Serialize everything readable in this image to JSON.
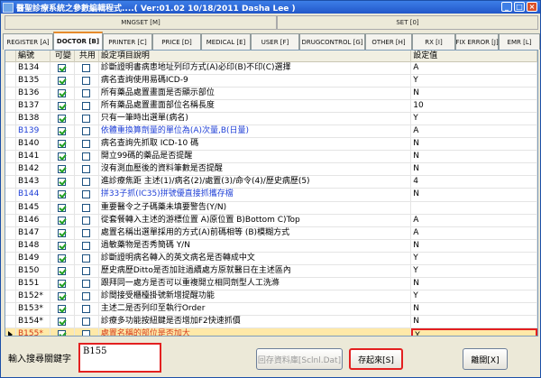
{
  "window": {
    "title": "醫聖診療系統之參數編輯程式....( Ver:01.02 10/18/2011 Dasha Lee )",
    "buttons": {
      "minimize": "_",
      "maximize": "□",
      "close": "×"
    }
  },
  "groups": [
    "MNGSET [M]",
    "SET [0]"
  ],
  "tabs": [
    {
      "label": "REGISTER [A]",
      "active": false
    },
    {
      "label": "DOCTOR [B]",
      "active": true
    },
    {
      "label": "PRINTER [C]",
      "active": false
    },
    {
      "label": "PRICE [D]",
      "active": false
    },
    {
      "label": "MEDICAL [E]",
      "active": false
    },
    {
      "label": "USER [F]",
      "active": false
    },
    {
      "label": "DRUGCONTROL [G]",
      "active": false
    },
    {
      "label": "OTHER [H]",
      "active": false
    },
    {
      "label": "RX [I]",
      "active": false
    },
    {
      "label": "FIX ERROR [J]",
      "active": false
    },
    {
      "label": "EMR [L]",
      "active": false
    }
  ],
  "grid": {
    "headers": {
      "code": "編號",
      "changeable": "可變",
      "common": "共用",
      "description": "設定項目說明",
      "value": "設定值"
    },
    "rows": [
      {
        "code": "B134",
        "chg": true,
        "com": false,
        "desc": "診斷證明書病患地址列印方式(A)必印(B)不印(C)選擇",
        "val": "A",
        "style": ""
      },
      {
        "code": "B135",
        "chg": true,
        "com": false,
        "desc": "病名查詢使用易碼ICD-9",
        "val": "Y",
        "style": ""
      },
      {
        "code": "B136",
        "chg": true,
        "com": false,
        "desc": "所有藥品處置畫面是否顯示部位",
        "val": "N",
        "style": ""
      },
      {
        "code": "B137",
        "chg": true,
        "com": false,
        "desc": "所有藥品處置畫面部位名稱長度",
        "val": "10",
        "style": ""
      },
      {
        "code": "B138",
        "chg": true,
        "com": false,
        "desc": "只有一筆時出選單(病名)",
        "val": "Y",
        "style": ""
      },
      {
        "code": "B139",
        "chg": true,
        "com": false,
        "desc": "依體重換算劑量的單位為(A)次量,B(日量)",
        "val": "A",
        "style": "blue"
      },
      {
        "code": "B140",
        "chg": true,
        "com": false,
        "desc": "病名查詢先抓取 ICD-10 碼",
        "val": "N",
        "style": ""
      },
      {
        "code": "B141",
        "chg": true,
        "com": false,
        "desc": "開立99碼的藥品是否提醒",
        "val": "N",
        "style": ""
      },
      {
        "code": "B142",
        "chg": true,
        "com": false,
        "desc": "沒有測血壓後的資料筆數是否提醒",
        "val": "N",
        "style": ""
      },
      {
        "code": "B143",
        "chg": true,
        "com": false,
        "desc": "進診療焦距 主述(1)/病名(2)/處置(3)/命令(4)/歷史病歷(5)",
        "val": "4",
        "style": ""
      },
      {
        "code": "B144",
        "chg": true,
        "com": false,
        "desc": "拼33子抓(IC35)拼號優直接抓攜存檔",
        "val": "N",
        "style": "blue"
      },
      {
        "code": "B145",
        "chg": true,
        "com": false,
        "desc": "重要醫令之子碼藥未填要警告(Y/N)",
        "val": "",
        "style": ""
      },
      {
        "code": "B146",
        "chg": true,
        "com": false,
        "desc": "從套餐轉入主述的游標位置 A)原位置 B)Bottom C)Top",
        "val": "A",
        "style": ""
      },
      {
        "code": "B147",
        "chg": true,
        "com": false,
        "desc": "處置名稱出選單採用的方式(A)前碼相等 (B)模糊方式",
        "val": "A",
        "style": ""
      },
      {
        "code": "B148",
        "chg": true,
        "com": false,
        "desc": "過敏藥物是否秀簡碼 Y/N",
        "val": "N",
        "style": ""
      },
      {
        "code": "B149",
        "chg": true,
        "com": false,
        "desc": "診斷證明病名轉入的英文病名是否轉成中文",
        "val": "Y",
        "style": ""
      },
      {
        "code": "B150",
        "chg": true,
        "com": false,
        "desc": "歷史病歷Ditto是否加註過續處方原就醫日在主述區內",
        "val": "Y",
        "style": ""
      },
      {
        "code": "B151",
        "chg": true,
        "com": false,
        "desc": "跟拜同一處方是否可以重複開立相同劑型人工洗滌",
        "val": "N",
        "style": ""
      },
      {
        "code": "B152*",
        "chg": true,
        "com": false,
        "desc": "診間接受櫃檯掛號新增提醒功能",
        "val": "Y",
        "style": ""
      },
      {
        "code": "B153*",
        "chg": true,
        "com": false,
        "desc": "主述二是否列印至執行Order",
        "val": "N",
        "style": ""
      },
      {
        "code": "B154*",
        "chg": true,
        "com": false,
        "desc": "診療多功能按紐鍵是否增加F2快速抓價",
        "val": "N",
        "style": ""
      },
      {
        "code": "B155*",
        "chg": true,
        "com": false,
        "desc": "處置名稱的部位是否加大",
        "val": "Y",
        "style": "red",
        "current": true
      }
    ]
  },
  "search": {
    "label": "輸入搜尋關鍵字",
    "value": "B155"
  },
  "buttons": {
    "restore": "回存資料庫[Sclnl.Dat]",
    "save": "存起來[S]",
    "close": "離開[X]"
  },
  "colors": {
    "accent": "#e68b2c",
    "highlight": "#e32020",
    "blue_text": "#1f3fd6",
    "red_text": "#d43a1a"
  }
}
